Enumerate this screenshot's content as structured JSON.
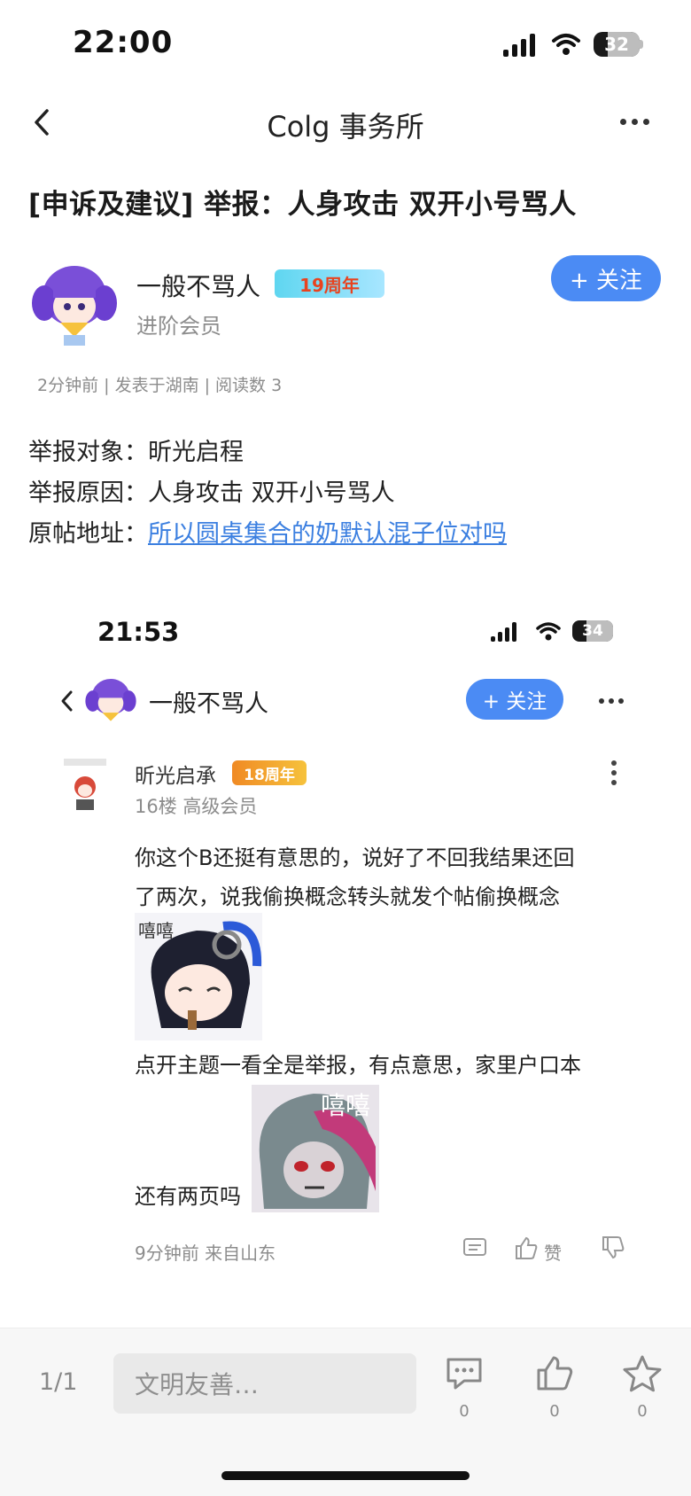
{
  "status_bar": {
    "time": "22:00",
    "battery": "32"
  },
  "nav": {
    "title": "Colg 事务所"
  },
  "post": {
    "title": "[申诉及建议] 举报：人身攻击 双开小号骂人",
    "author": {
      "name": "一般不骂人",
      "badge": "19周年",
      "rank": "进阶会员"
    },
    "follow_label": "+ 关注",
    "meta": "2分钟前 | 发表于湖南 | 阅读数 3",
    "report": {
      "target_label": "举报对象：",
      "target_value": "昕光启程",
      "reason_label": "举报原因：",
      "reason_value": "人身攻击 双开小号骂人",
      "link_label": "原帖地址：",
      "link_value": "所以圆桌集合的奶默认混子位对吗"
    }
  },
  "screenshot": {
    "time": "21:53",
    "battery": "34",
    "header_name": "一般不骂人",
    "follow_label": "+ 关注",
    "comment": {
      "user": "昕光启承",
      "badge": "18周年",
      "floor_rank": "16楼  高级会员",
      "line1": "你这个B还挺有意思的，说好了不回我结果还回",
      "line2": "了两次，说我偷换概念转头就发个帖偷换概念",
      "sticker1_text": "嘻嘻",
      "line3": "点开主题一看全是举报，有点意思，家里户口本",
      "line4": "还有两页吗",
      "sticker2_text": "嘻嘻",
      "footer": "9分钟前  来自山东",
      "like_label": "赞"
    }
  },
  "bottom_bar": {
    "page": "1/1",
    "input_placeholder": "文明友善…",
    "comment_count": "0",
    "like_count": "0",
    "favorite_count": "0"
  },
  "colors": {
    "accent": "#4b8bf4",
    "link": "#3b7fe0",
    "meta": "#8c8c8c"
  },
  "icons": [
    "back-arrow-icon",
    "more-icon",
    "comment-icon",
    "thumb-up-icon",
    "thumb-down-icon",
    "star-icon",
    "wifi-icon",
    "signal-icon",
    "battery-icon"
  ]
}
